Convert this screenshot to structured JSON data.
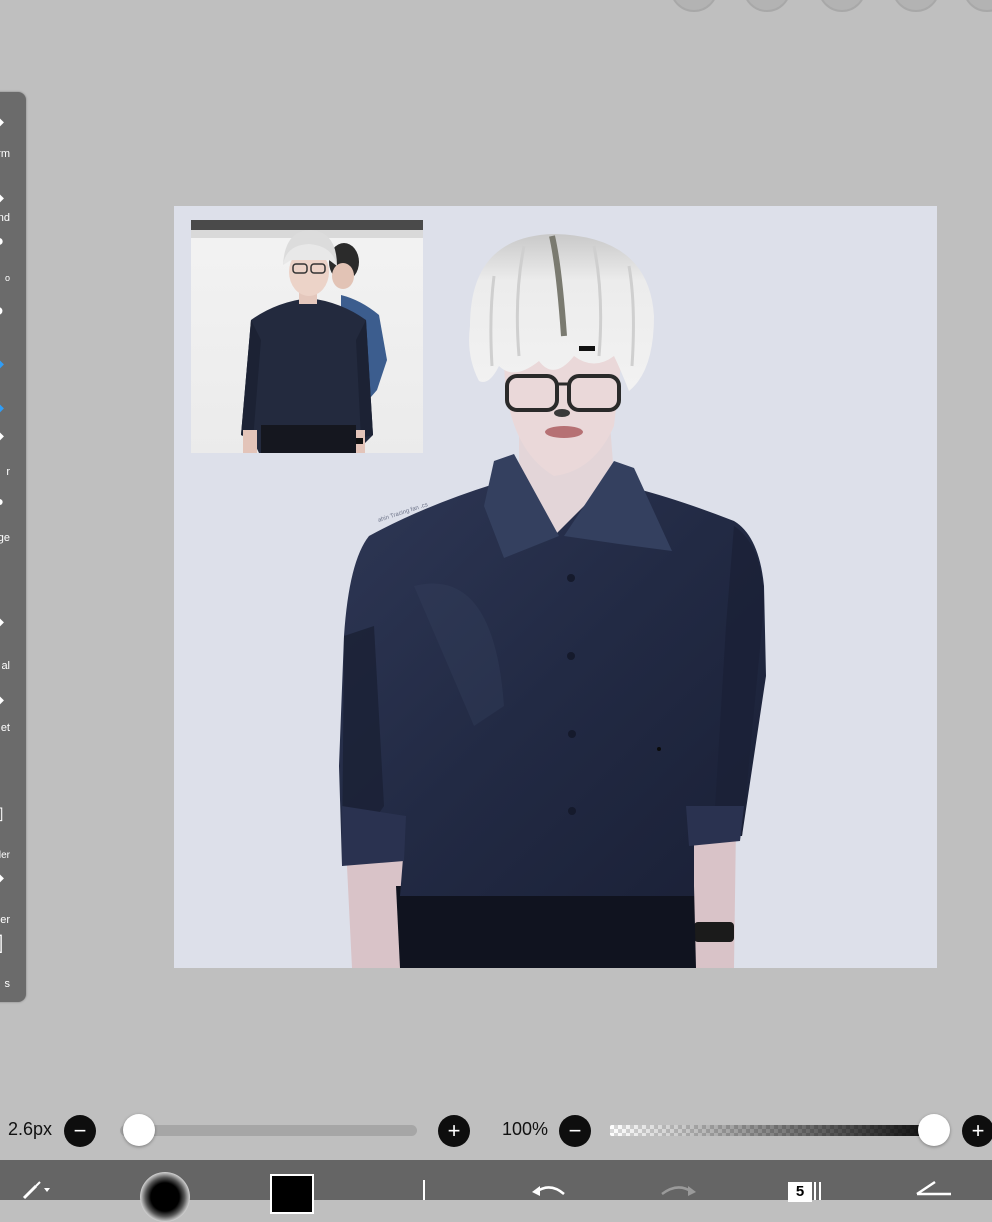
{
  "toolbar": {
    "items": [
      {
        "icon": "transform-icon",
        "label": "rm"
      },
      {
        "icon": "magic-wand-icon",
        "label": "and"
      },
      {
        "icon": "lasso-icon",
        "label": "o"
      },
      {
        "icon": "filter-icon",
        "label": ""
      },
      {
        "icon": "brush-icon",
        "label": ""
      },
      {
        "icon": "eraser-icon",
        "label": ""
      },
      {
        "icon": "smudge-icon",
        "label": "r"
      },
      {
        "icon": "blur-icon",
        "label": "ge"
      },
      {
        "icon": "bucket-icon",
        "label": "al"
      },
      {
        "icon": "text-icon",
        "label": "et"
      },
      {
        "icon": "frame-divider-icon",
        "label": "ider"
      },
      {
        "icon": "eyedropper-icon",
        "label": "per"
      },
      {
        "icon": "canvas-icon",
        "label": "s"
      }
    ]
  },
  "artwork": {
    "signature": "ahin Tracing fan .cs"
  },
  "brush": {
    "size_label": "2.6px",
    "size_value": 0.02,
    "opacity_label": "100%",
    "opacity_value": 1.0
  },
  "bottombar": {
    "layers_count": "5"
  },
  "colors": {
    "background": "#bfbfbf",
    "toolbar": "#6b6b6b",
    "canvas": "#dde0ea",
    "shirt": "#232b45",
    "hair": "#e6e6e6",
    "accent": "#2f9df7",
    "current_color": "#000000"
  }
}
